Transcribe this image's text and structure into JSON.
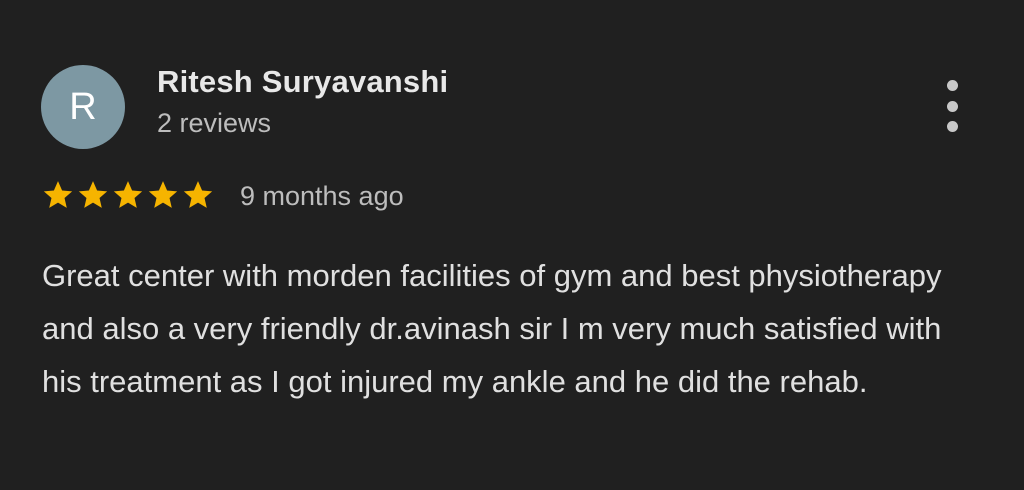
{
  "review": {
    "avatar_letter": "R",
    "author_name": "Ritesh Suryavanshi",
    "review_count": "2 reviews",
    "rating": 5,
    "rating_max": 5,
    "time_ago": "9 months ago",
    "text": "Great center with morden facilities of gym and best physiotherapy and also a very friendly dr.avinash sir I m very much satisfied with his treatment as I got injured my ankle and he did the rehab.",
    "more_icon": "more-vert-icon",
    "star_icon": "star-icon"
  },
  "colors": {
    "background": "#202020",
    "avatar_bg": "#7d98a3",
    "star": "#f6b400",
    "primary_text": "#e8e8e8",
    "secondary_text": "#bdbdbd"
  }
}
